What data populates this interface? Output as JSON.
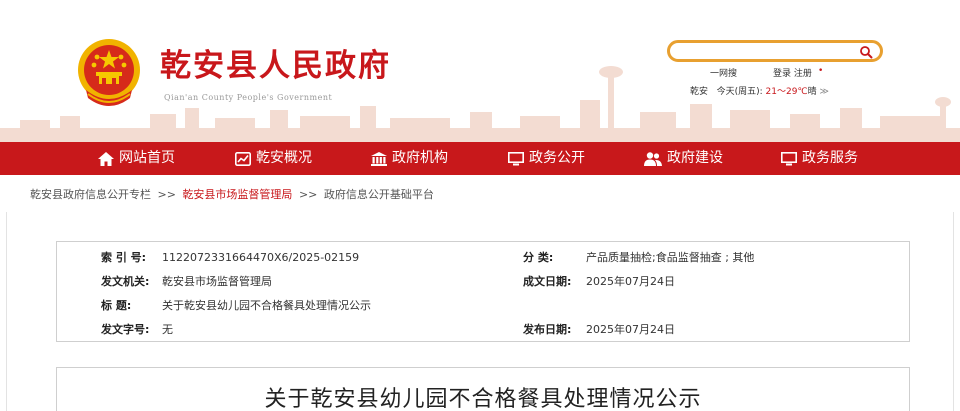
{
  "header": {
    "title": "乾安县人民政府",
    "subtitle": "Qian'an County People's Government",
    "search_placeholder": "",
    "links": {
      "yiwang": "一网搜",
      "login": "登录 注册",
      "login_dot": "•"
    },
    "weather": {
      "city": "乾安",
      "day": "今天(周五):",
      "temp": "21～29℃",
      "condition": "晴",
      "more": "≫"
    }
  },
  "nav": {
    "items": [
      {
        "label": "网站首页",
        "icon": "home-icon"
      },
      {
        "label": "乾安概况",
        "icon": "chart-icon"
      },
      {
        "label": "政府机构",
        "icon": "building-icon"
      },
      {
        "label": "政务公开",
        "icon": "monitor-icon"
      },
      {
        "label": "政府建设",
        "icon": "people-icon"
      },
      {
        "label": "政务服务",
        "icon": "monitor-icon"
      }
    ]
  },
  "breadcrumb": {
    "items": [
      "乾安县政府信息公开专栏",
      "乾安县市场监督管理局",
      "政府信息公开基础平台"
    ],
    "separator": ">>"
  },
  "info": {
    "index_label": "索 引 号:",
    "index_value": "1122072331664470X6/2025-02159",
    "category_label": "分 类:",
    "category_value": "产品质量抽检;食品监督抽查 ; 其他",
    "issuer_label": "发文机关:",
    "issuer_value": "乾安县市场监督管理局",
    "created_label": "成文日期:",
    "created_value": "2025年07月24日",
    "title_label": "标 题:",
    "title_value": "关于乾安县幼儿园不合格餐具处理情况公示",
    "docno_label": "发文字号:",
    "docno_value": "无",
    "published_label": "发布日期:",
    "published_value": "2025年07月24日"
  },
  "article": {
    "title": "关于乾安县幼儿园不合格餐具处理情况公示"
  },
  "colors": {
    "brand_red": "#c8181b",
    "search_border": "#e8a030"
  }
}
